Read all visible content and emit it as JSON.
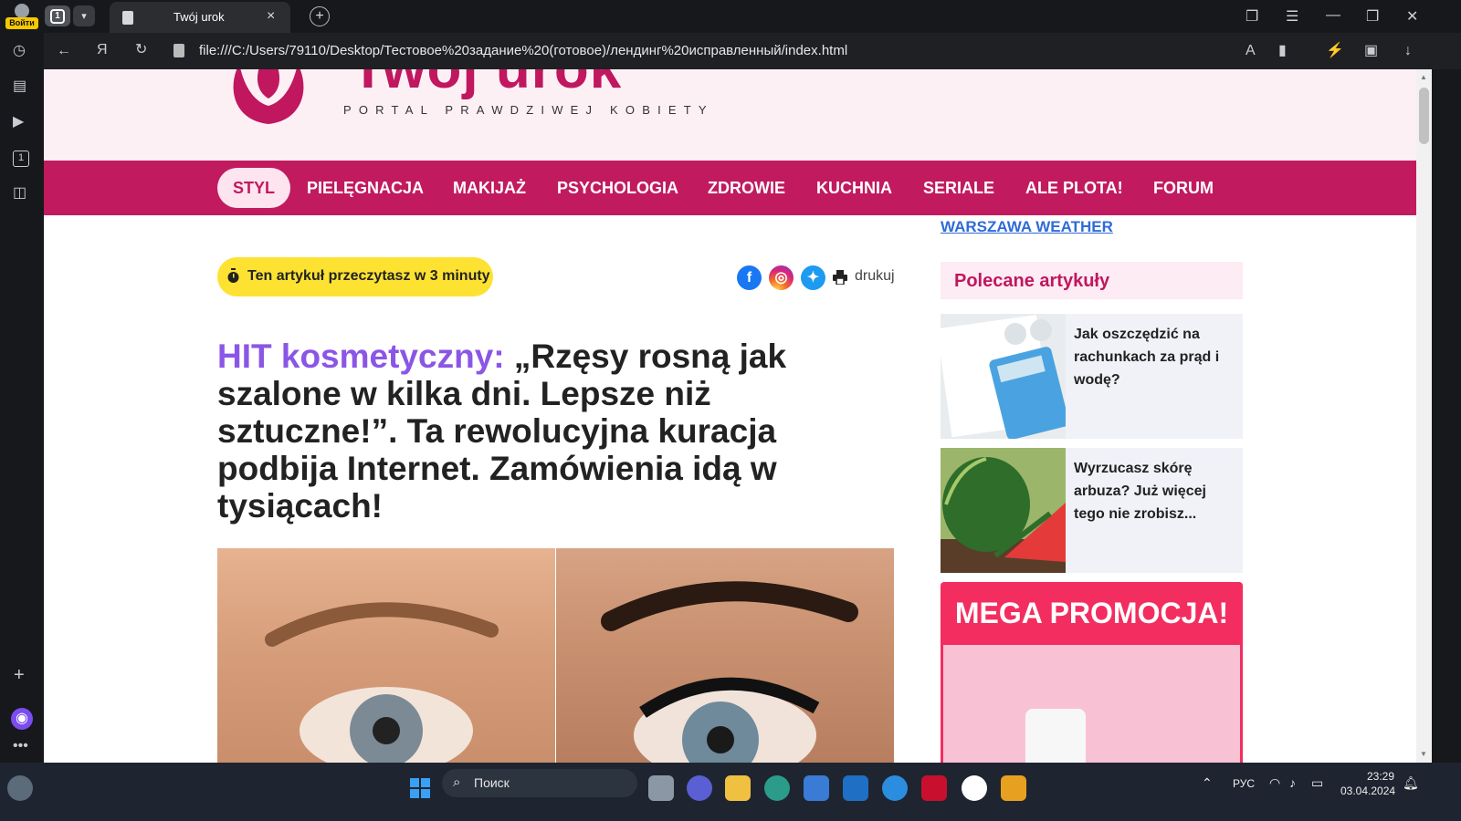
{
  "browser": {
    "profile_badge": "Войти",
    "tab_count": "1",
    "tab_title": "Twój urok",
    "url": "file:///C:/Users/79110/Desktop/Тестовое%20задание%20(готовое)/лендинг%20исправленный/index.html",
    "sidebar_badge": "1"
  },
  "site": {
    "logo": "Twój urok",
    "tagline": "PORTAL PRAWDZIWEJ KOBIETY",
    "nav": [
      "STYL",
      "PIELĘGNACJA",
      "MAKIJAŻ",
      "PSYCHOLOGIA",
      "ZDROWIE",
      "KUCHNIA",
      "SERIALE",
      "ALE PLOTA!",
      "FORUM"
    ],
    "weather_link": "WARSZAWA WEATHER"
  },
  "article": {
    "read_time": "Ten artykuł przeczytasz w 3 minuty",
    "print_label": "drukuj",
    "headline_highlight": "HIT kosmetyczny:",
    "headline_rest": "„Rzęsy rosną jak szalone w kilka dni. Lepsze niż sztuczne!”. Ta rewolucyjna kuracja podbija Internet. Zamówienia idą w tysiącach!"
  },
  "sidebar": {
    "title": "Polecane artykuły",
    "cards": [
      {
        "text": "Jak oszczędzić na rachunkach za prąd i wodę?"
      },
      {
        "text": "Wyrzucasz skórę arbuza? Już więcej tego nie zrobisz..."
      }
    ],
    "promo_title": "MEGA PROMOCJA!"
  },
  "taskbar": {
    "search_placeholder": "Поиск",
    "language": "РУС",
    "time": "23:29",
    "date": "03.04.2024"
  },
  "colors": {
    "brand": "#c11a5f",
    "highlight": "#8b56e6",
    "readtime_bg": "#fde232",
    "promo": "#f32d5f"
  }
}
